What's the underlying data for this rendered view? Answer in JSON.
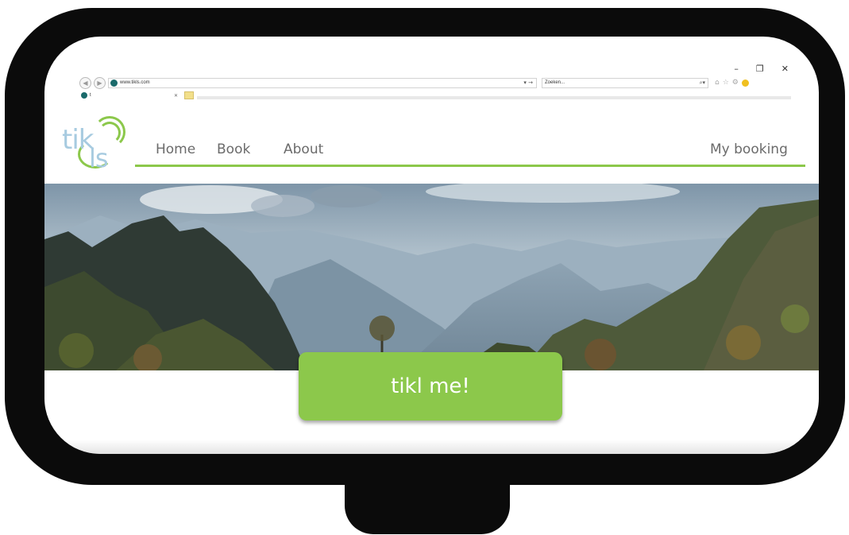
{
  "browser": {
    "url": "www.tikls.com",
    "search_placeholder": "Zoeken...",
    "tab_title": "t",
    "window_controls": {
      "minimize": "–",
      "restore": "❐",
      "close": "✕"
    },
    "icons": [
      "back-icon",
      "forward-icon",
      "home-icon",
      "favorites-star-icon",
      "settings-gear-icon",
      "feedback-smiley-icon"
    ]
  },
  "site": {
    "logo": {
      "top": "tik",
      "bottom": "ls"
    },
    "nav": {
      "home": "Home",
      "book": "Book",
      "about": "About",
      "my_booking": "My booking"
    },
    "cta": "tikl me!",
    "colors": {
      "accent": "#8cc84b",
      "logo_text": "#a7cbe0",
      "nav_text": "#6b6b6b"
    }
  }
}
